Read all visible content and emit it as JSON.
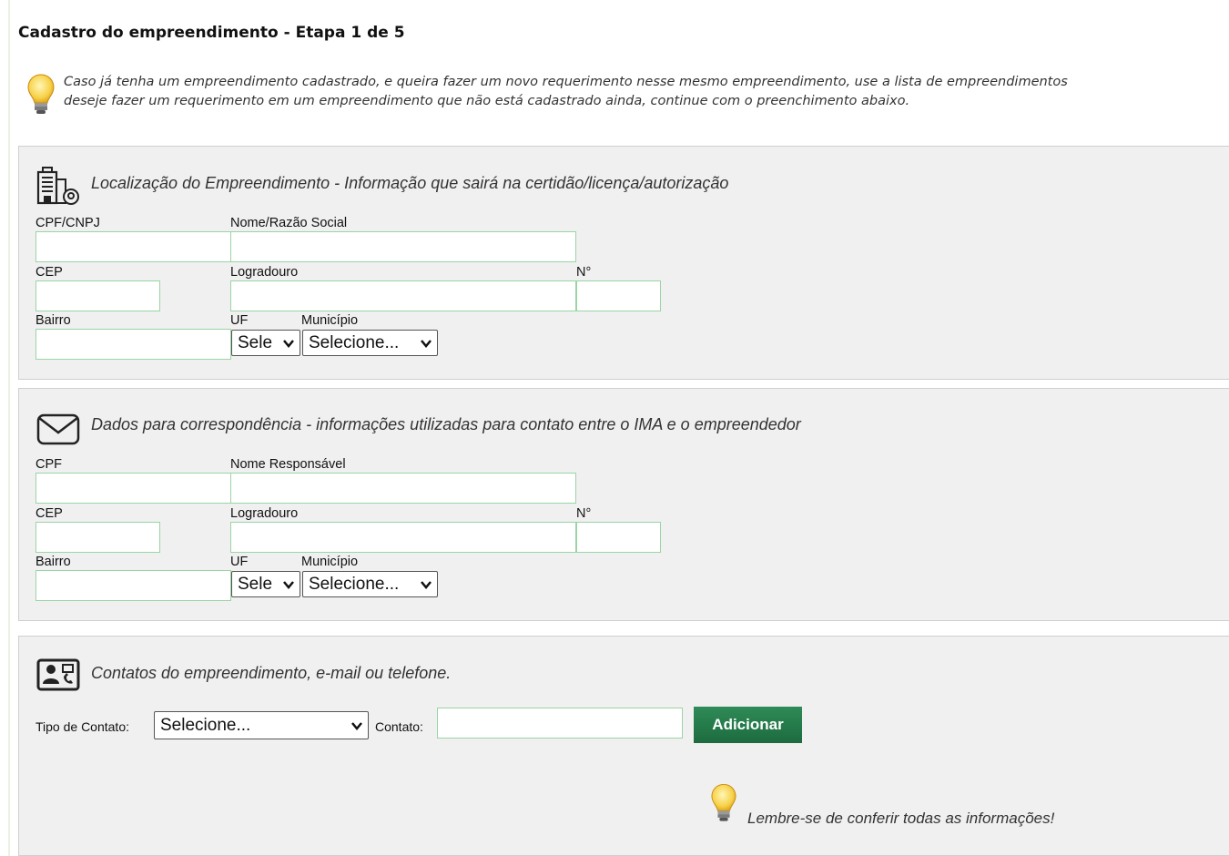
{
  "page": {
    "title": "Cadastro do empreendimento - Etapa 1 de 5",
    "tip_line1": "Caso já tenha um empreendimento cadastrado, e queira fazer um novo requerimento nesse mesmo empreendimento, use a lista de empreendimentos",
    "tip_line2": "deseje fazer um requerimento em um empreendimento que não está cadastrado ainda, continue com o preenchimento abaixo."
  },
  "location": {
    "title": "Localização do Empreendimento - Informação que sairá na certidão/licença/autorização",
    "cpf_cnpj_label": "CPF/CNPJ",
    "name_label": "Nome/Razão Social",
    "cep_label": "CEP",
    "street_label": "Logradouro",
    "number_label": "N°",
    "district_label": "Bairro",
    "uf_label": "UF",
    "city_label": "Município",
    "uf_value": "Sele",
    "city_value": "Selecione..."
  },
  "correspondence": {
    "title": "Dados para correspondência - informações utilizadas para contato entre o IMA e o empreendedor",
    "cpf_label": "CPF",
    "name_label": "Nome Responsável",
    "cep_label": "CEP",
    "street_label": "Logradouro",
    "number_label": "N°",
    "district_label": "Bairro",
    "uf_label": "UF",
    "city_label": "Município",
    "uf_value": "Sele",
    "city_value": "Selecione..."
  },
  "contacts": {
    "title": "Contatos do empreendimento, e-mail ou telefone.",
    "type_label": "Tipo de Contato:",
    "type_value": "Selecione...",
    "contact_label": "Contato:",
    "add_button": "Adicionar",
    "reminder": "Lembre-se de conferir todas as informações!"
  },
  "colors": {
    "panel_bg": "#f0f0f0",
    "input_border": "#99d5a4",
    "button_green": "#2e8b57"
  },
  "icons": [
    "lightbulb-icon",
    "building-location-icon",
    "envelope-icon",
    "contact-card-icon",
    "chevron-down-icon"
  ]
}
